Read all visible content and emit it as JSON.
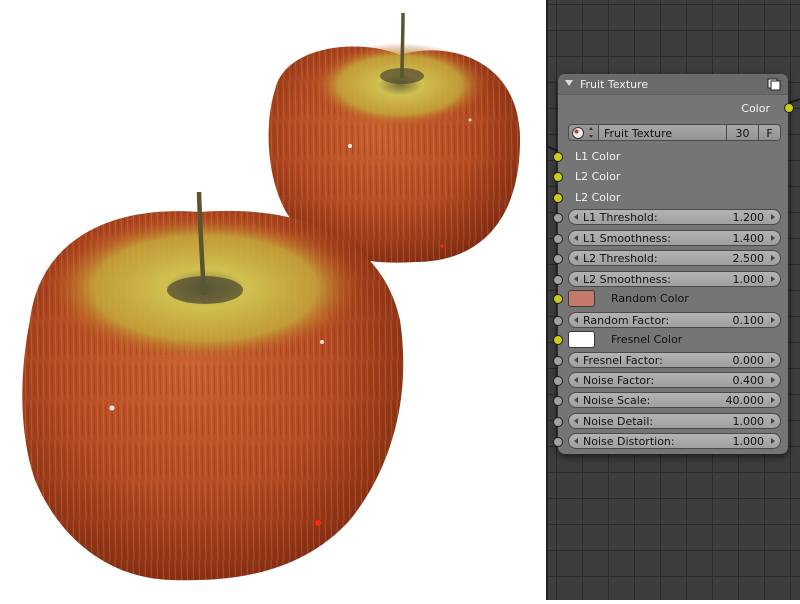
{
  "node": {
    "title": "Fruit Texture",
    "output_label": "Color",
    "texture_name": "Fruit Texture",
    "texture_users": "30",
    "fake_user": "F",
    "color_inputs": [
      "L1 Color",
      "L2 Color",
      "L2 Color"
    ],
    "threshold_fields": [
      {
        "label": "L1 Threshold:",
        "value": "1.200"
      },
      {
        "label": "L1 Smoothness:",
        "value": "1.400"
      },
      {
        "label": "L2 Threshold:",
        "value": "2.500"
      },
      {
        "label": "L2 Smoothness:",
        "value": "1.000"
      }
    ],
    "random_color": {
      "label": "Random Color",
      "color": "#c47a6a"
    },
    "random_factor": {
      "label": "Random Factor:",
      "value": "0.100"
    },
    "fresnel_color": {
      "label": "Fresnel Color",
      "color": "#ffffff"
    },
    "noise_fields": [
      {
        "label": "Fresnel Factor:",
        "value": "0.000"
      },
      {
        "label": "Noise Factor:",
        "value": "0.400"
      },
      {
        "label": "Noise Scale:",
        "value": "40.000"
      },
      {
        "label": "Noise Detail:",
        "value": "1.000"
      },
      {
        "label": "Noise Distortion:",
        "value": "1.000"
      }
    ]
  },
  "colors": {
    "socket_color": "#cccc1a",
    "socket_value": "#a1a1a1",
    "node_body": "#757575",
    "apple_red": "#b8471f",
    "apple_yellow": "#c6b23a"
  },
  "icons": {
    "collapse": "triangle-down-icon",
    "preview": "node-preview-icon",
    "texture_browse": "texture-browse-icon"
  }
}
